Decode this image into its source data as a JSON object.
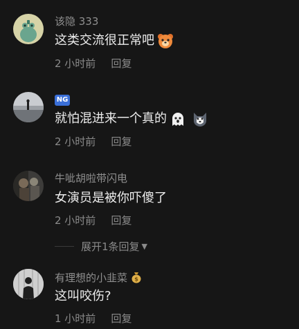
{
  "comments": [
    {
      "username": "该隐 333",
      "text": "这类交流很正常吧",
      "emoji": "bear-emoji",
      "time": "2 小时前",
      "reply": "回复"
    },
    {
      "badge": "NG",
      "text": "就怕混进来一个真的",
      "emojis": [
        "ghost-emoji",
        "husky-emoji"
      ],
      "time": "2 小时前",
      "reply": "回复"
    },
    {
      "username": "牛呲胡啦带闪电",
      "text": "女演员是被你吓傻了",
      "time": "2 小时前",
      "reply": "回复"
    },
    {
      "username": "有理想的小韭菜",
      "username_emoji": "money-bag-emoji",
      "text": "这叫咬伤?",
      "time": "1 小时前",
      "reply": "回复"
    }
  ],
  "expand_replies": "展开1条回复",
  "icons": {
    "expand_caret": "caret-down-icon"
  }
}
